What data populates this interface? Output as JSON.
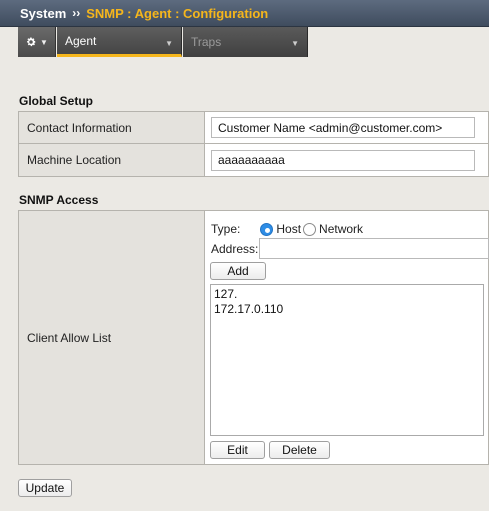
{
  "breadcrumb": {
    "root": "System",
    "separator": "››",
    "page": "SNMP : Agent : Configuration"
  },
  "tabs": [
    {
      "label": "Agent",
      "active": true
    },
    {
      "label": "Traps",
      "active": false
    }
  ],
  "global_setup": {
    "title": "Global Setup",
    "contact_label": "Contact Information",
    "contact_value": "Customer Name <admin@customer.com>",
    "location_label": "Machine Location",
    "location_value": "aaaaaaaaaa"
  },
  "snmp_access": {
    "title": "SNMP Access",
    "client_allow_label": "Client Allow List",
    "type_label": "Type:",
    "type_options": [
      "Host",
      "Network"
    ],
    "type_selected": "Host",
    "address_label": "Address:",
    "address_value": "",
    "add_label": "Add",
    "clients": [
      "127.",
      "172.17.0.110"
    ],
    "edit_label": "Edit",
    "delete_label": "Delete"
  },
  "update_label": "Update",
  "colors": {
    "accent": "#f5b61c",
    "titlebar": "#4b586b",
    "radio_selected": "#2e8de6"
  }
}
